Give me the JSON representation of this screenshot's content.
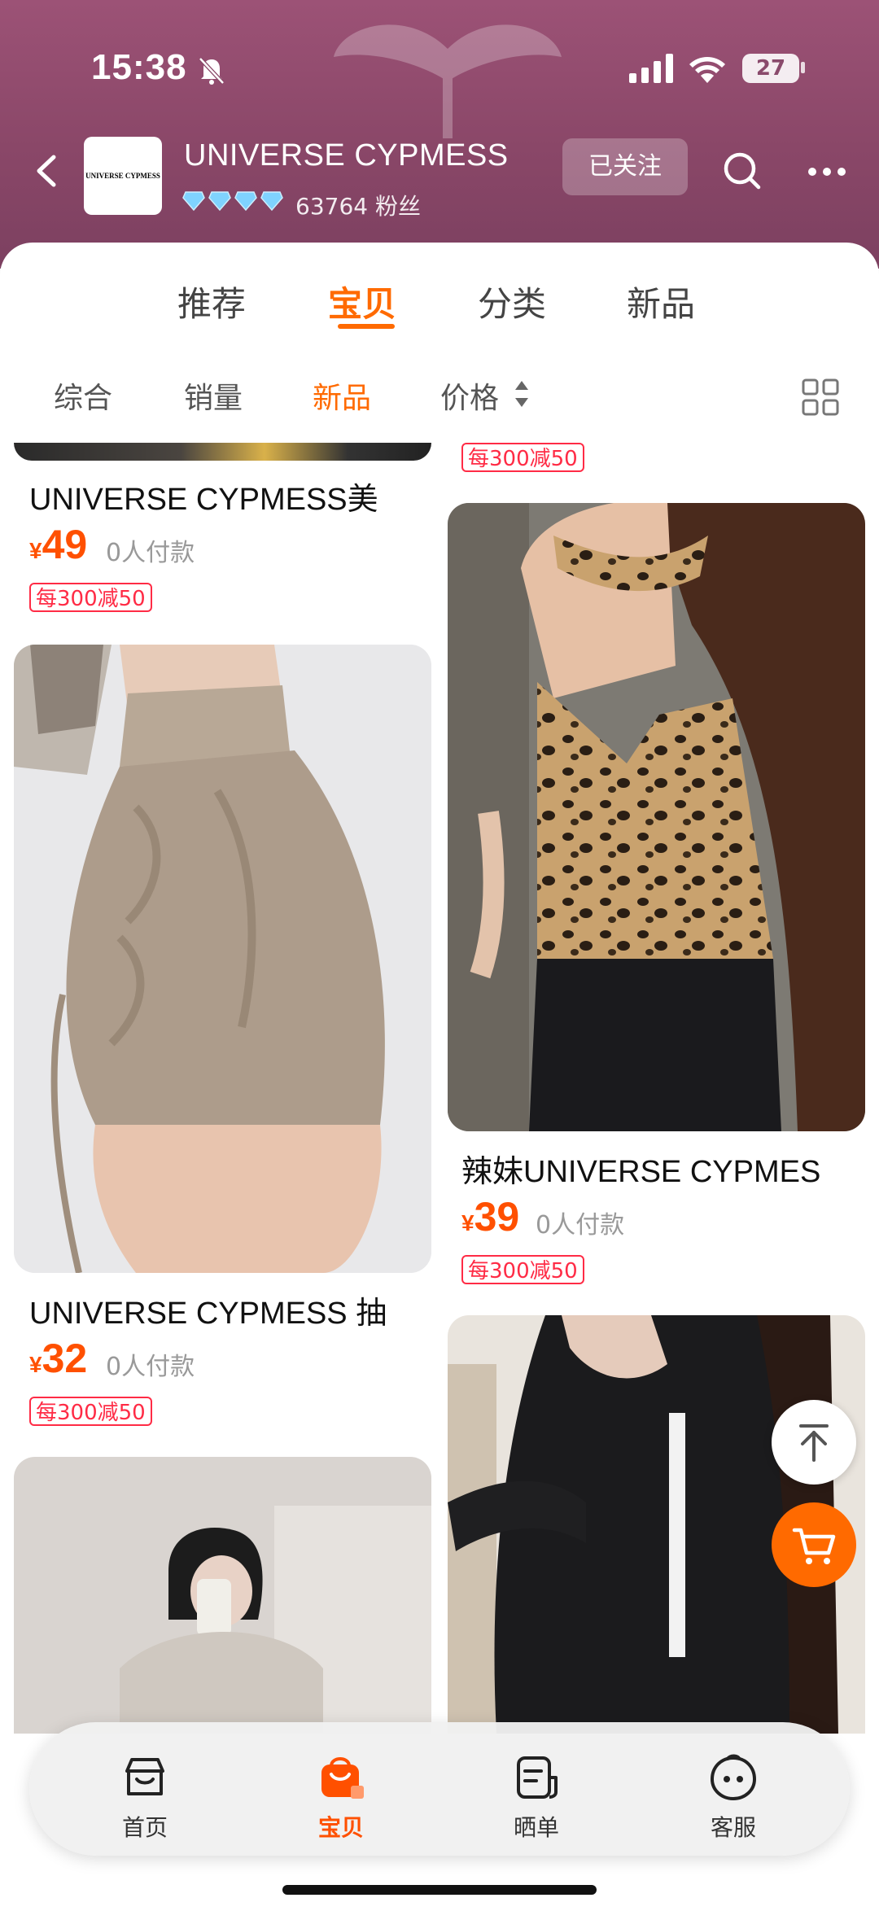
{
  "status_bar": {
    "time": "15:38",
    "battery": "27"
  },
  "shop": {
    "logo_text": "UNIVERSE CYPMESS",
    "name": "UNIVERSE CYPMESS",
    "fans": "63764 粉丝",
    "follow_label": "已关注"
  },
  "tabs": [
    {
      "label": "推荐"
    },
    {
      "label": "宝贝"
    },
    {
      "label": "分类"
    },
    {
      "label": "新品"
    }
  ],
  "filters": [
    {
      "label": "综合"
    },
    {
      "label": "销量"
    },
    {
      "label": "新品"
    },
    {
      "label": "价格"
    }
  ],
  "products": [
    {
      "title": "UNIVERSE CYPMESS美",
      "currency": "¥",
      "price": "49",
      "paid": "0人付款",
      "promo": "每300减50"
    },
    {
      "title": "UNIVERSE CYPMESS 抽",
      "currency": "¥",
      "price": "32",
      "paid": "0人付款",
      "promo": "每300减50"
    },
    {
      "title": "辣妹UNIVERSE CYPMES",
      "currency": "¥",
      "price": "39",
      "paid": "0人付款",
      "promo": "每300减50"
    }
  ],
  "partial_promo": "每300减50",
  "bottom_nav": [
    {
      "label": "首页"
    },
    {
      "label": "宝贝"
    },
    {
      "label": "晒单"
    },
    {
      "label": "客服"
    }
  ],
  "colors": {
    "accent": "#ff6a00",
    "price": "#ff5000",
    "promo": "#ff2b45",
    "header": "#8a4768"
  }
}
